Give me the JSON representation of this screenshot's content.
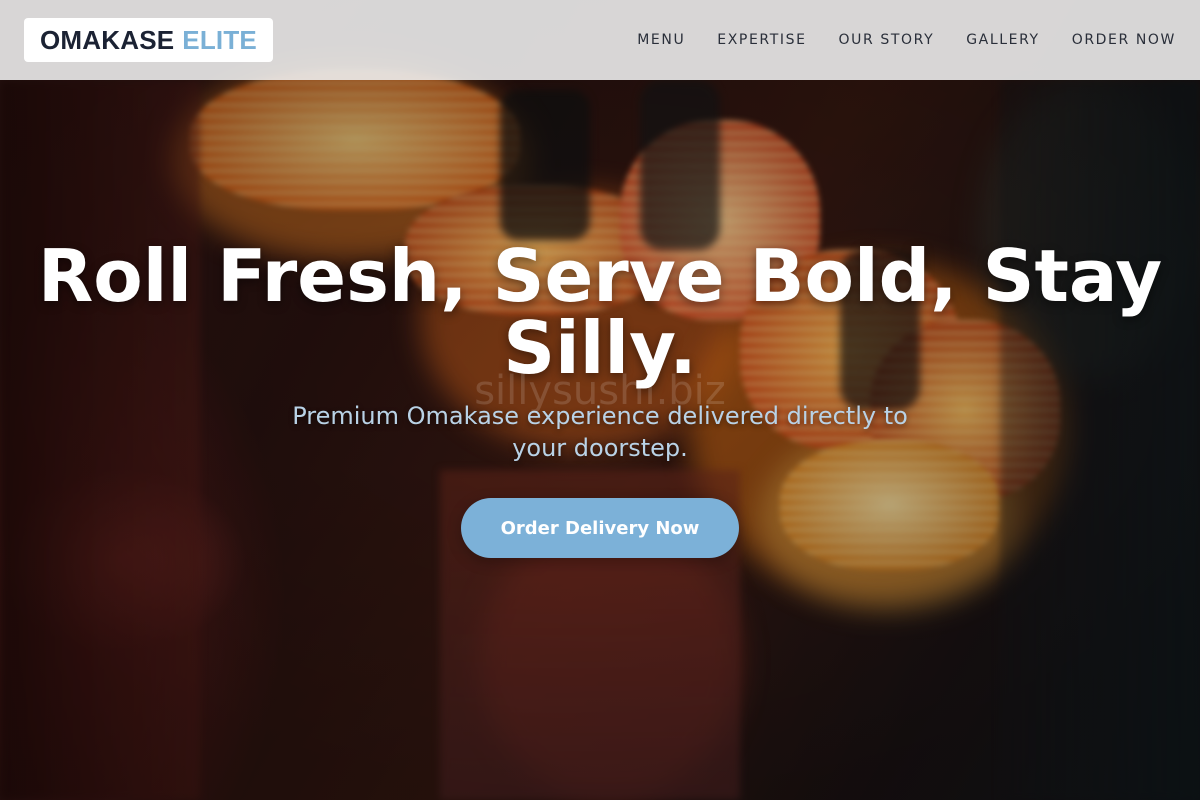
{
  "brand": {
    "name_main": "OMAKASE",
    "name_accent": "ELITE",
    "accent_color": "#7ab0d6",
    "dark_color": "#1b2233"
  },
  "nav": {
    "items": [
      {
        "label": "MENU"
      },
      {
        "label": "EXPERTISE"
      },
      {
        "label": "OUR STORY"
      },
      {
        "label": "GALLERY"
      },
      {
        "label": "ORDER NOW"
      }
    ]
  },
  "hero": {
    "headline": "Roll Fresh, Serve Bold, Stay Silly.",
    "watermark": "sillysushi.biz",
    "subheadline": "Premium Omakase experience delivered directly to your doorstep.",
    "cta_label": "Order Delivery Now",
    "cta_color": "#7cb1d8",
    "background": "blurred night street with glowing paper lanterns"
  }
}
